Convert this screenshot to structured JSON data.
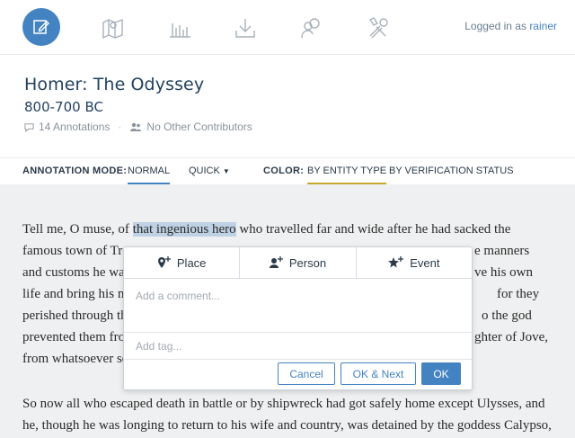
{
  "nav": {
    "icons": [
      "edit-icon",
      "map-icon",
      "bar-chart-icon",
      "download-icon",
      "people-icon",
      "tools-icon"
    ],
    "logged_in_prefix": "Logged in as",
    "username": "rainer"
  },
  "document": {
    "title": "Homer: The Odyssey",
    "date": "800-700 BC",
    "annotations": "14 Annotations",
    "contributors": "No Other Contributors"
  },
  "modebar": {
    "annotation_mode_label": "ANNOTATION MODE:",
    "normal": "NORMAL",
    "quick": "QUICK",
    "color_label": "COLOR:",
    "by_entity_type": "BY ENTITY TYPE",
    "by_verification_status": "BY VERIFICATION STATUS"
  },
  "text": {
    "p1_line1_pre": "Tell me, O muse, of ",
    "p1_highlight": "that ingenious hero",
    "p1_line1_post": " who travelled far and wide after he had sacked the",
    "p1_line2_start": "famous town of Tro",
    "p1_line2_end": "e manners",
    "p1_line3_start": "and customs he wa",
    "p1_line3_end": "ve his own",
    "p1_line4_start": "life and bring his m",
    "p1_line4_end": "for they",
    "p1_line5_start": "perished through th",
    "p1_line5_end": "o the god",
    "p1_line6_start": "prevented them fro",
    "p1_line6_end": "ghter of Jove,",
    "p1_line7_start": "from whatsoever so",
    "p2_line1": "So now all who escaped death in battle or by shipwreck had got safely home except Ulysses, and",
    "p2_line2": "he, though he was longing to return to his wife and country, was detained by the goddess Calypso,"
  },
  "popup": {
    "place": "Place",
    "person": "Person",
    "event": "Event",
    "comment_placeholder": "Add a comment...",
    "tag_placeholder": "Add tag...",
    "cancel": "Cancel",
    "ok_next": "OK & Next",
    "ok": "OK"
  },
  "colors": {
    "accent": "#4483c2",
    "highlight": "#bfd1e4",
    "gold": "#c9a92c"
  }
}
